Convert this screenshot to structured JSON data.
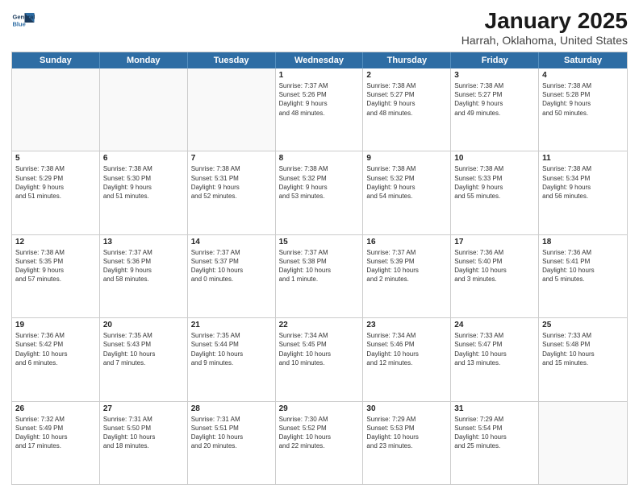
{
  "header": {
    "logo_line1": "General",
    "logo_line2": "Blue",
    "title": "January 2025",
    "subtitle": "Harrah, Oklahoma, United States"
  },
  "days_of_week": [
    "Sunday",
    "Monday",
    "Tuesday",
    "Wednesday",
    "Thursday",
    "Friday",
    "Saturday"
  ],
  "weeks": [
    [
      {
        "day": "",
        "info": ""
      },
      {
        "day": "",
        "info": ""
      },
      {
        "day": "",
        "info": ""
      },
      {
        "day": "1",
        "info": "Sunrise: 7:37 AM\nSunset: 5:26 PM\nDaylight: 9 hours\nand 48 minutes."
      },
      {
        "day": "2",
        "info": "Sunrise: 7:38 AM\nSunset: 5:27 PM\nDaylight: 9 hours\nand 48 minutes."
      },
      {
        "day": "3",
        "info": "Sunrise: 7:38 AM\nSunset: 5:27 PM\nDaylight: 9 hours\nand 49 minutes."
      },
      {
        "day": "4",
        "info": "Sunrise: 7:38 AM\nSunset: 5:28 PM\nDaylight: 9 hours\nand 50 minutes."
      }
    ],
    [
      {
        "day": "5",
        "info": "Sunrise: 7:38 AM\nSunset: 5:29 PM\nDaylight: 9 hours\nand 51 minutes."
      },
      {
        "day": "6",
        "info": "Sunrise: 7:38 AM\nSunset: 5:30 PM\nDaylight: 9 hours\nand 51 minutes."
      },
      {
        "day": "7",
        "info": "Sunrise: 7:38 AM\nSunset: 5:31 PM\nDaylight: 9 hours\nand 52 minutes."
      },
      {
        "day": "8",
        "info": "Sunrise: 7:38 AM\nSunset: 5:32 PM\nDaylight: 9 hours\nand 53 minutes."
      },
      {
        "day": "9",
        "info": "Sunrise: 7:38 AM\nSunset: 5:32 PM\nDaylight: 9 hours\nand 54 minutes."
      },
      {
        "day": "10",
        "info": "Sunrise: 7:38 AM\nSunset: 5:33 PM\nDaylight: 9 hours\nand 55 minutes."
      },
      {
        "day": "11",
        "info": "Sunrise: 7:38 AM\nSunset: 5:34 PM\nDaylight: 9 hours\nand 56 minutes."
      }
    ],
    [
      {
        "day": "12",
        "info": "Sunrise: 7:38 AM\nSunset: 5:35 PM\nDaylight: 9 hours\nand 57 minutes."
      },
      {
        "day": "13",
        "info": "Sunrise: 7:37 AM\nSunset: 5:36 PM\nDaylight: 9 hours\nand 58 minutes."
      },
      {
        "day": "14",
        "info": "Sunrise: 7:37 AM\nSunset: 5:37 PM\nDaylight: 10 hours\nand 0 minutes."
      },
      {
        "day": "15",
        "info": "Sunrise: 7:37 AM\nSunset: 5:38 PM\nDaylight: 10 hours\nand 1 minute."
      },
      {
        "day": "16",
        "info": "Sunrise: 7:37 AM\nSunset: 5:39 PM\nDaylight: 10 hours\nand 2 minutes."
      },
      {
        "day": "17",
        "info": "Sunrise: 7:36 AM\nSunset: 5:40 PM\nDaylight: 10 hours\nand 3 minutes."
      },
      {
        "day": "18",
        "info": "Sunrise: 7:36 AM\nSunset: 5:41 PM\nDaylight: 10 hours\nand 5 minutes."
      }
    ],
    [
      {
        "day": "19",
        "info": "Sunrise: 7:36 AM\nSunset: 5:42 PM\nDaylight: 10 hours\nand 6 minutes."
      },
      {
        "day": "20",
        "info": "Sunrise: 7:35 AM\nSunset: 5:43 PM\nDaylight: 10 hours\nand 7 minutes."
      },
      {
        "day": "21",
        "info": "Sunrise: 7:35 AM\nSunset: 5:44 PM\nDaylight: 10 hours\nand 9 minutes."
      },
      {
        "day": "22",
        "info": "Sunrise: 7:34 AM\nSunset: 5:45 PM\nDaylight: 10 hours\nand 10 minutes."
      },
      {
        "day": "23",
        "info": "Sunrise: 7:34 AM\nSunset: 5:46 PM\nDaylight: 10 hours\nand 12 minutes."
      },
      {
        "day": "24",
        "info": "Sunrise: 7:33 AM\nSunset: 5:47 PM\nDaylight: 10 hours\nand 13 minutes."
      },
      {
        "day": "25",
        "info": "Sunrise: 7:33 AM\nSunset: 5:48 PM\nDaylight: 10 hours\nand 15 minutes."
      }
    ],
    [
      {
        "day": "26",
        "info": "Sunrise: 7:32 AM\nSunset: 5:49 PM\nDaylight: 10 hours\nand 17 minutes."
      },
      {
        "day": "27",
        "info": "Sunrise: 7:31 AM\nSunset: 5:50 PM\nDaylight: 10 hours\nand 18 minutes."
      },
      {
        "day": "28",
        "info": "Sunrise: 7:31 AM\nSunset: 5:51 PM\nDaylight: 10 hours\nand 20 minutes."
      },
      {
        "day": "29",
        "info": "Sunrise: 7:30 AM\nSunset: 5:52 PM\nDaylight: 10 hours\nand 22 minutes."
      },
      {
        "day": "30",
        "info": "Sunrise: 7:29 AM\nSunset: 5:53 PM\nDaylight: 10 hours\nand 23 minutes."
      },
      {
        "day": "31",
        "info": "Sunrise: 7:29 AM\nSunset: 5:54 PM\nDaylight: 10 hours\nand 25 minutes."
      },
      {
        "day": "",
        "info": ""
      }
    ]
  ]
}
